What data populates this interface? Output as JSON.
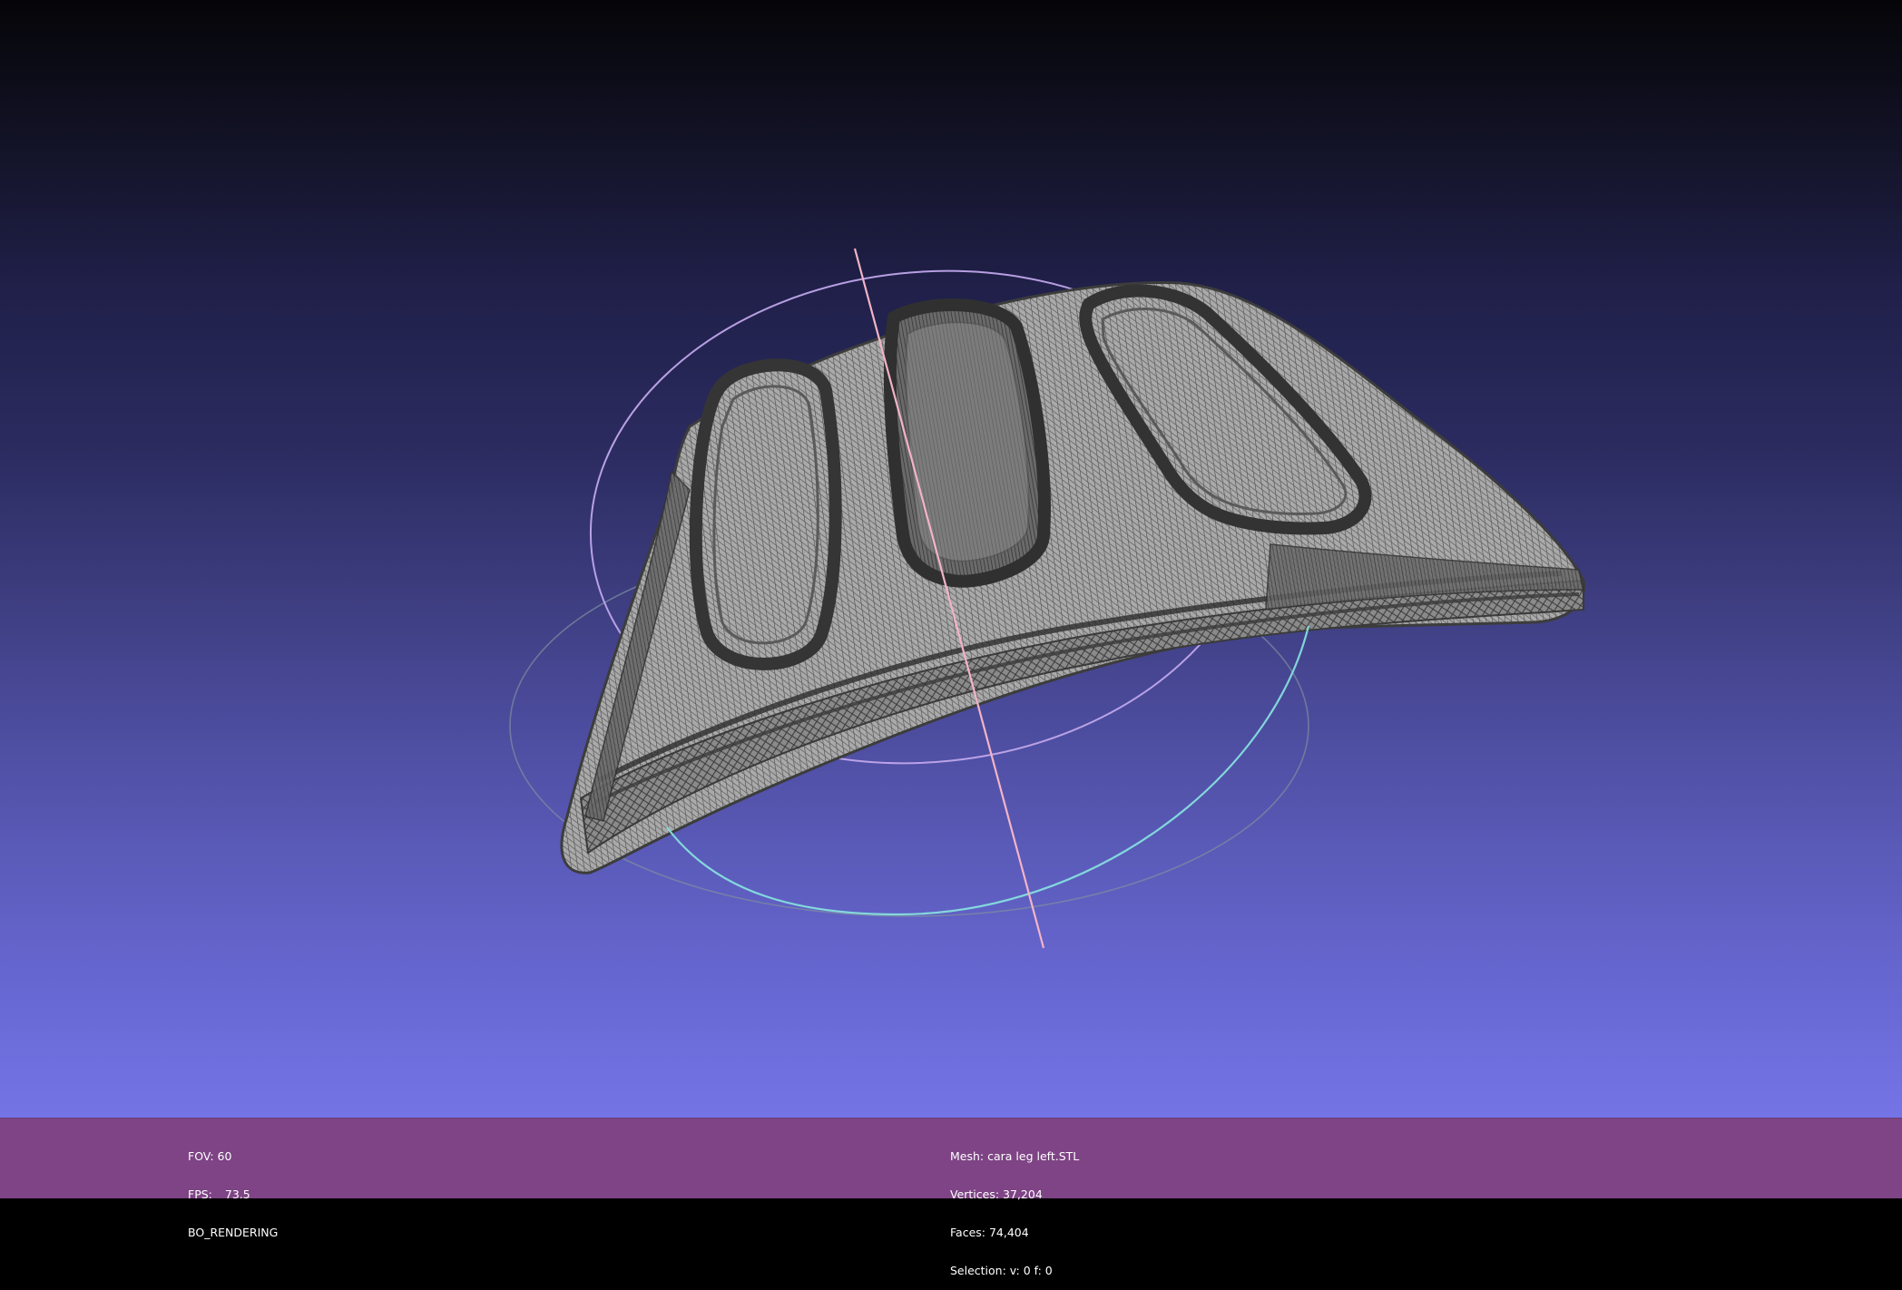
{
  "viewport": {
    "background_top": "#050508",
    "background_bottom": "#7474e6",
    "mesh_fill": "#a9a9a9",
    "mesh_wire": "#3a3a3a",
    "trackball_colors": {
      "horizontal": "#7fd6d6",
      "vertical": "#c9a3e8",
      "axis": "#f0b0c0"
    }
  },
  "status_bar": {
    "background": "#7e4485",
    "left": {
      "fov_label": "FOV: 60",
      "fps_label": "FPS:",
      "fps_value": "73.5",
      "render_mode": "BO_RENDERING"
    },
    "center": {
      "mesh": "Mesh: cara leg left.STL",
      "vertices": "Vertices: 37,204",
      "faces": "Faces: 74,404",
      "selection": "Selection: v: 0 f: 0"
    }
  }
}
